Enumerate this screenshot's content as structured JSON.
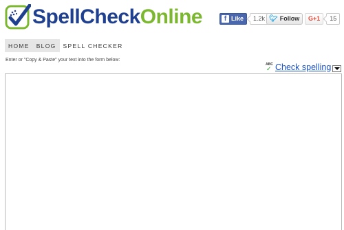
{
  "header": {
    "logo": {
      "part1": "Spell",
      "part2": "Check",
      "part3": "Online"
    }
  },
  "social": {
    "facebook": {
      "label": "Like",
      "count": "1.2k"
    },
    "twitter": {
      "label": "Follow"
    },
    "googleplus": {
      "label": "G+1",
      "count": "15"
    }
  },
  "nav": {
    "items": [
      {
        "label": "HOME"
      },
      {
        "label": "BLOG"
      },
      {
        "label": "SPELL CHECKER"
      }
    ]
  },
  "main": {
    "instructions": "Enter or \"Copy & Paste\" your text into the form below:",
    "check_spelling": "Check spelling",
    "abc": "ABC",
    "editor_value": ""
  },
  "colors": {
    "logo_blue": "#1f3f8f",
    "logo_green": "#7cb82f",
    "link": "#1a4fc4",
    "facebook": "#4a66ad",
    "twitter": "#2ea7de",
    "googleplus": "#dd4b39"
  }
}
